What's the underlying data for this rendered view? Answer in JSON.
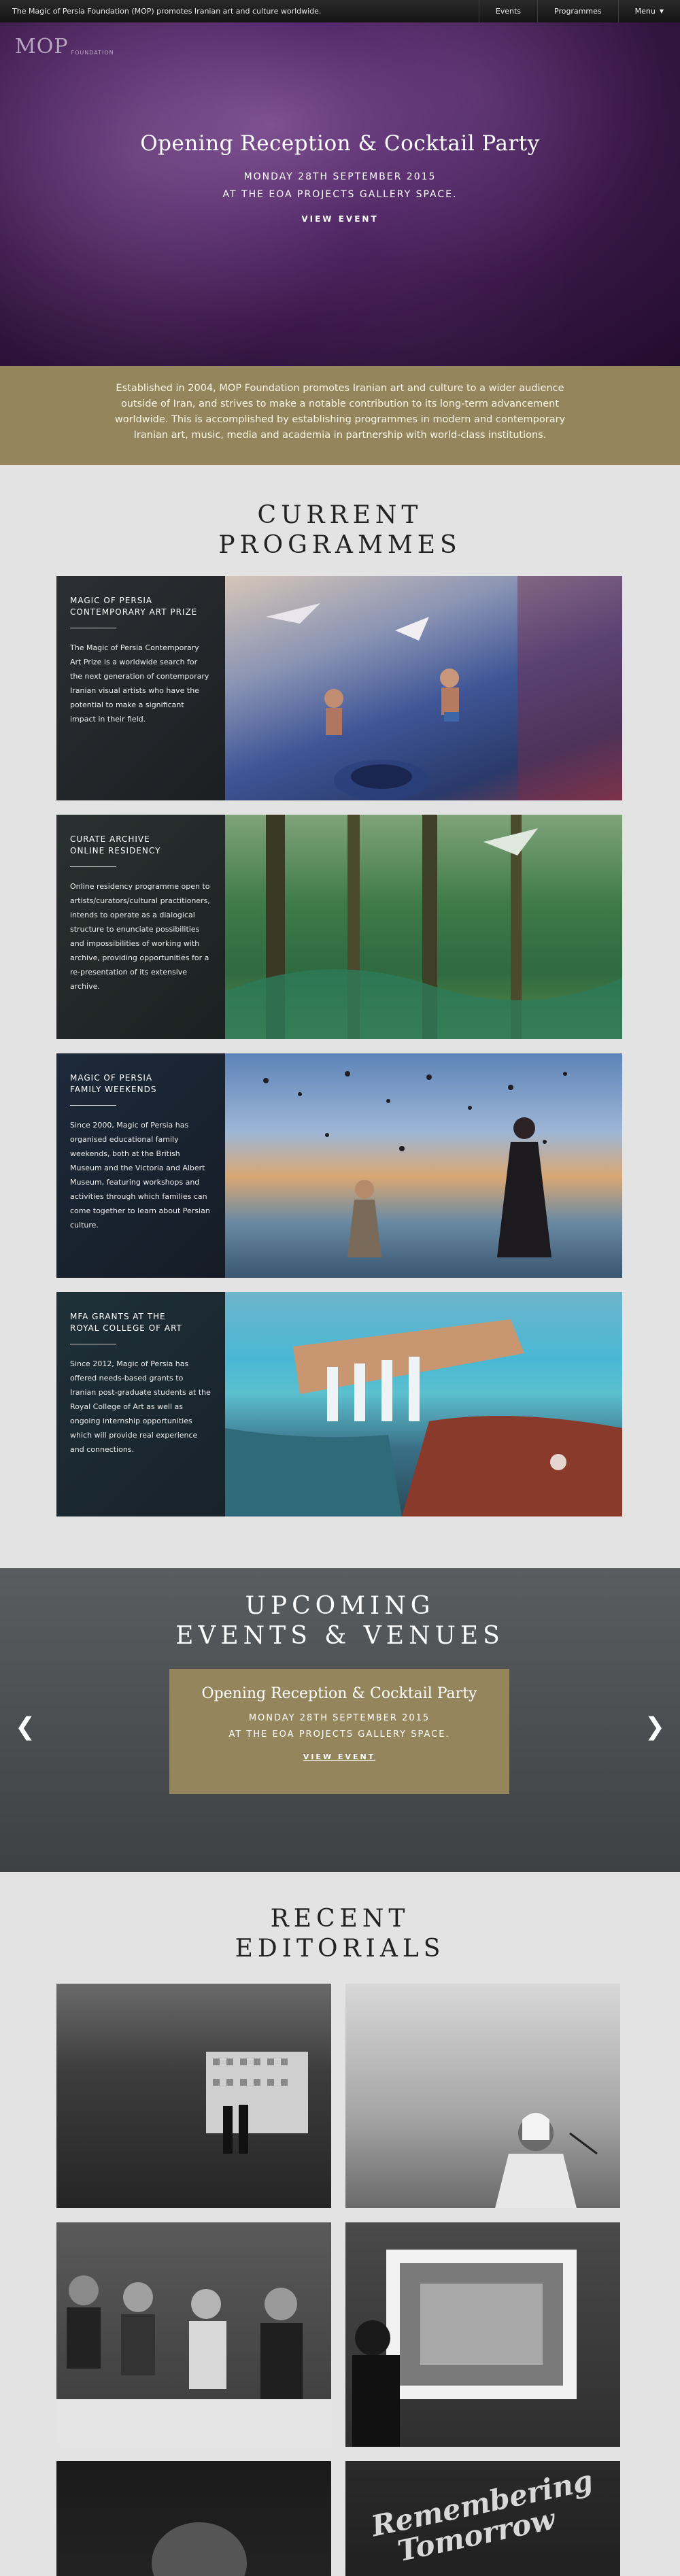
{
  "topbar": {
    "tagline": "The Magic of Persia Foundation (MOP) promotes Iranian art and culture worldwide.",
    "nav": [
      {
        "label": "Events"
      },
      {
        "label": "Programmes"
      },
      {
        "label": "Menu"
      }
    ]
  },
  "logo": {
    "mark": "MOP",
    "sub": "FOUNDATION"
  },
  "hero": {
    "title": "Opening Reception & Cocktail Party",
    "date": "MONDAY 28TH SEPTEMBER 2015",
    "venue": "AT THE EOA PROJECTS GALLERY SPACE.",
    "button": "VIEW EVENT"
  },
  "about": {
    "text": "Established in 2004, MOP Foundation promotes Iranian art and culture to a wider audience outside of Iran, and strives to make a notable contribution to its long-term advancement worldwide. This is accomplished by establishing programmes in modern and contemporary Iranian art, music, media and academia in partnership with world-class institutions."
  },
  "programmes": {
    "title_line1": "CURRENT",
    "title_line2": "PROGRAMMES",
    "items": [
      {
        "title_line1": "MAGIC OF PERSIA",
        "title_line2": "CONTEMPORARY ART PRIZE",
        "text": "The Magic of Persia Contemporary Art Prize is a worldwide search for the next generation of contemporary Iranian visual artists who have the potential to make a significant impact in their field."
      },
      {
        "title_line1": "CURATE ARCHIVE",
        "title_line2": "ONLINE RESIDENCY",
        "text": "Online residency programme open to artists/curators/cultural practitioners, intends to operate as a dialogical structure to enunciate possibilities and impossibilities of working with archive, providing opportunities for a re-presentation of its extensive archive."
      },
      {
        "title_line1": "MAGIC OF PERSIA",
        "title_line2": "FAMILY WEEKENDS",
        "text": "Since 2000, Magic of Persia has organised educational family weekends, both at the British Museum and the Victoria and Albert Museum, featuring workshops and activities through which families can come together to learn about Persian culture."
      },
      {
        "title_line1": "MFA GRANTS AT THE",
        "title_line2": "ROYAL COLLEGE OF ART",
        "text": "Since 2012, Magic of Persia has offered needs-based grants to Iranian post-graduate students at the Royal College of Art as well as ongoing internship opportunities which will provide real experience and connections."
      }
    ]
  },
  "events": {
    "title_line1": "UPCOMING",
    "title_line2": "EVENTS & VENUES",
    "card": {
      "title": "Opening Reception & Cocktail Party",
      "date": "MONDAY 28TH SEPTEMBER 2015",
      "venue": "AT THE EOA PROJECTS GALLERY SPACE.",
      "button": "VIEW EVENT"
    },
    "prev_icon": "chevron-left-icon",
    "next_icon": "chevron-right-icon"
  },
  "editorials": {
    "title_line1": "RECENT",
    "title_line2": "EDITORIALS",
    "partial_text_line1": "Remembering",
    "partial_text_line2": "Tomorrow"
  },
  "colors": {
    "accent_gold": "#94855c",
    "hero_purple": "#3a1748",
    "topbar": "#1c1c1c",
    "page_bg": "#e3e3e3"
  }
}
